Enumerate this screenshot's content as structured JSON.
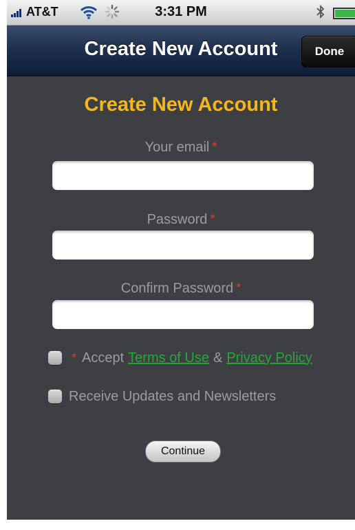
{
  "status_bar": {
    "carrier": "AT&T",
    "time": "3:31 PM",
    "icons": [
      "signal-icon",
      "wifi-icon",
      "activity-spinner-icon",
      "bluetooth-icon",
      "battery-icon"
    ]
  },
  "nav": {
    "title": "Create New Account",
    "done_label": "Done"
  },
  "form": {
    "heading": "Create New Account",
    "required_marker": "*",
    "email": {
      "label": "Your email",
      "value": "",
      "placeholder": ""
    },
    "password": {
      "label": "Password",
      "value": "",
      "placeholder": ""
    },
    "confirm_password": {
      "label": "Confirm Password",
      "value": "",
      "placeholder": ""
    },
    "accept": {
      "prefix": "Accept",
      "terms_link": "Terms of Use",
      "ampersand": "&",
      "privacy_link": "Privacy Policy",
      "checked": false
    },
    "updates": {
      "label": "Receive Updates and Newsletters",
      "checked": false
    },
    "continue_label": "Continue"
  },
  "colors": {
    "background": "#3d3f43",
    "heading": "#f3b61d",
    "label": "#9a9ca0",
    "required": "#e23b2e",
    "link": "#27a63a",
    "nav_bar": "#1f3150"
  }
}
